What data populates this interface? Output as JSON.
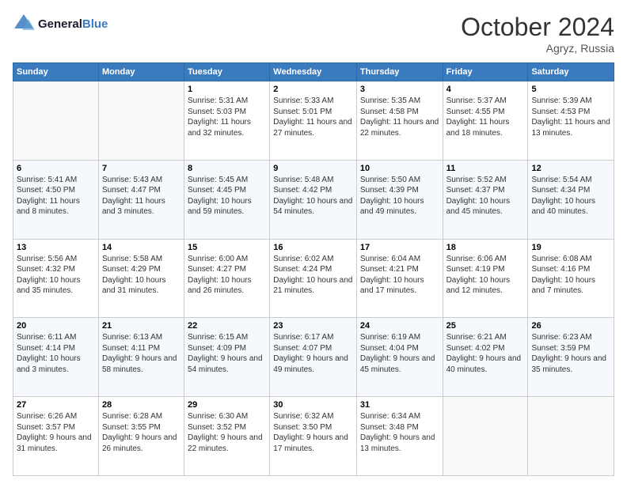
{
  "logo": {
    "line1": "General",
    "line2": "Blue"
  },
  "title": "October 2024",
  "location": "Agryz, Russia",
  "days_of_week": [
    "Sunday",
    "Monday",
    "Tuesday",
    "Wednesday",
    "Thursday",
    "Friday",
    "Saturday"
  ],
  "weeks": [
    [
      {
        "day": "",
        "info": ""
      },
      {
        "day": "",
        "info": ""
      },
      {
        "day": "1",
        "info": "Sunrise: 5:31 AM\nSunset: 5:03 PM\nDaylight: 11 hours and 32 minutes."
      },
      {
        "day": "2",
        "info": "Sunrise: 5:33 AM\nSunset: 5:01 PM\nDaylight: 11 hours and 27 minutes."
      },
      {
        "day": "3",
        "info": "Sunrise: 5:35 AM\nSunset: 4:58 PM\nDaylight: 11 hours and 22 minutes."
      },
      {
        "day": "4",
        "info": "Sunrise: 5:37 AM\nSunset: 4:55 PM\nDaylight: 11 hours and 18 minutes."
      },
      {
        "day": "5",
        "info": "Sunrise: 5:39 AM\nSunset: 4:53 PM\nDaylight: 11 hours and 13 minutes."
      }
    ],
    [
      {
        "day": "6",
        "info": "Sunrise: 5:41 AM\nSunset: 4:50 PM\nDaylight: 11 hours and 8 minutes."
      },
      {
        "day": "7",
        "info": "Sunrise: 5:43 AM\nSunset: 4:47 PM\nDaylight: 11 hours and 3 minutes."
      },
      {
        "day": "8",
        "info": "Sunrise: 5:45 AM\nSunset: 4:45 PM\nDaylight: 10 hours and 59 minutes."
      },
      {
        "day": "9",
        "info": "Sunrise: 5:48 AM\nSunset: 4:42 PM\nDaylight: 10 hours and 54 minutes."
      },
      {
        "day": "10",
        "info": "Sunrise: 5:50 AM\nSunset: 4:39 PM\nDaylight: 10 hours and 49 minutes."
      },
      {
        "day": "11",
        "info": "Sunrise: 5:52 AM\nSunset: 4:37 PM\nDaylight: 10 hours and 45 minutes."
      },
      {
        "day": "12",
        "info": "Sunrise: 5:54 AM\nSunset: 4:34 PM\nDaylight: 10 hours and 40 minutes."
      }
    ],
    [
      {
        "day": "13",
        "info": "Sunrise: 5:56 AM\nSunset: 4:32 PM\nDaylight: 10 hours and 35 minutes."
      },
      {
        "day": "14",
        "info": "Sunrise: 5:58 AM\nSunset: 4:29 PM\nDaylight: 10 hours and 31 minutes."
      },
      {
        "day": "15",
        "info": "Sunrise: 6:00 AM\nSunset: 4:27 PM\nDaylight: 10 hours and 26 minutes."
      },
      {
        "day": "16",
        "info": "Sunrise: 6:02 AM\nSunset: 4:24 PM\nDaylight: 10 hours and 21 minutes."
      },
      {
        "day": "17",
        "info": "Sunrise: 6:04 AM\nSunset: 4:21 PM\nDaylight: 10 hours and 17 minutes."
      },
      {
        "day": "18",
        "info": "Sunrise: 6:06 AM\nSunset: 4:19 PM\nDaylight: 10 hours and 12 minutes."
      },
      {
        "day": "19",
        "info": "Sunrise: 6:08 AM\nSunset: 4:16 PM\nDaylight: 10 hours and 7 minutes."
      }
    ],
    [
      {
        "day": "20",
        "info": "Sunrise: 6:11 AM\nSunset: 4:14 PM\nDaylight: 10 hours and 3 minutes."
      },
      {
        "day": "21",
        "info": "Sunrise: 6:13 AM\nSunset: 4:11 PM\nDaylight: 9 hours and 58 minutes."
      },
      {
        "day": "22",
        "info": "Sunrise: 6:15 AM\nSunset: 4:09 PM\nDaylight: 9 hours and 54 minutes."
      },
      {
        "day": "23",
        "info": "Sunrise: 6:17 AM\nSunset: 4:07 PM\nDaylight: 9 hours and 49 minutes."
      },
      {
        "day": "24",
        "info": "Sunrise: 6:19 AM\nSunset: 4:04 PM\nDaylight: 9 hours and 45 minutes."
      },
      {
        "day": "25",
        "info": "Sunrise: 6:21 AM\nSunset: 4:02 PM\nDaylight: 9 hours and 40 minutes."
      },
      {
        "day": "26",
        "info": "Sunrise: 6:23 AM\nSunset: 3:59 PM\nDaylight: 9 hours and 35 minutes."
      }
    ],
    [
      {
        "day": "27",
        "info": "Sunrise: 6:26 AM\nSunset: 3:57 PM\nDaylight: 9 hours and 31 minutes."
      },
      {
        "day": "28",
        "info": "Sunrise: 6:28 AM\nSunset: 3:55 PM\nDaylight: 9 hours and 26 minutes."
      },
      {
        "day": "29",
        "info": "Sunrise: 6:30 AM\nSunset: 3:52 PM\nDaylight: 9 hours and 22 minutes."
      },
      {
        "day": "30",
        "info": "Sunrise: 6:32 AM\nSunset: 3:50 PM\nDaylight: 9 hours and 17 minutes."
      },
      {
        "day": "31",
        "info": "Sunrise: 6:34 AM\nSunset: 3:48 PM\nDaylight: 9 hours and 13 minutes."
      },
      {
        "day": "",
        "info": ""
      },
      {
        "day": "",
        "info": ""
      }
    ]
  ]
}
